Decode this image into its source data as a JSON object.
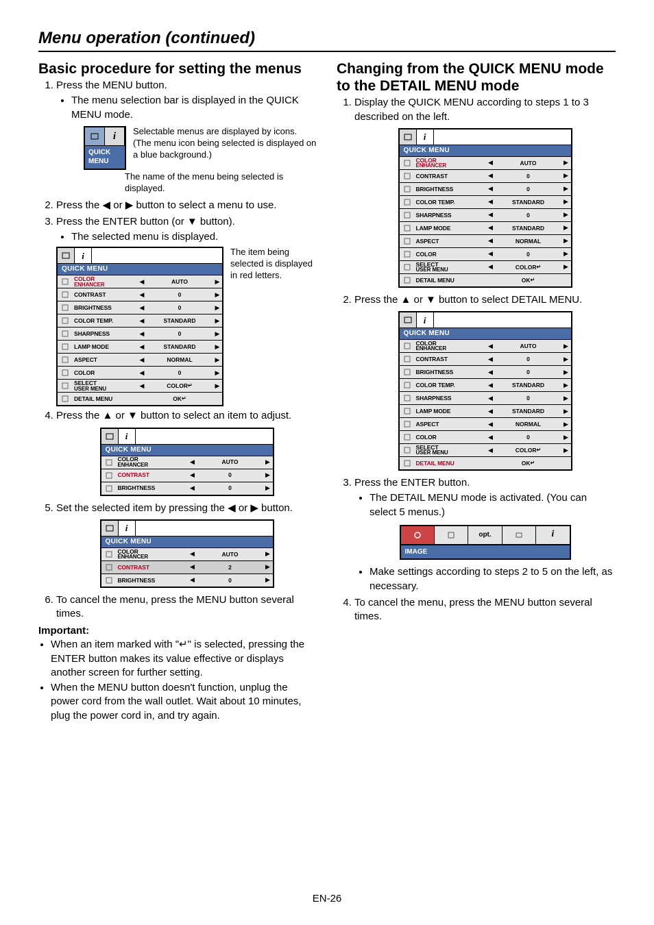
{
  "page_title": "Menu operation (continued)",
  "page_number": "EN-26",
  "left": {
    "h2": "Basic procedure for setting the menus",
    "steps": [
      "Press the MENU button.",
      "Press the ◀ or ▶ button to select a menu to use.",
      "Press the ENTER button (or ▼ button).",
      "Press the ▲ or ▼ button to select an item to adjust.",
      "Set the selected item by pressing the ◀ or ▶ button.",
      "To cancel the menu, press the MENU button several times."
    ],
    "sub1": "The menu selection bar is displayed in the QUICK MENU mode.",
    "sub3": "The selected menu is displayed.",
    "callout1": "Selectable menus are displayed by icons. (The menu icon being selected is displayed on a blue background.)",
    "callout2": "The name of the menu being selected is displayed.",
    "callout3": "The item being selected is displayed in red letters.",
    "quick_menu_label": "QUICK MENU",
    "important_label": "Important:",
    "important": [
      "When an item marked with \"↵\" is selected, pressing the ENTER button makes its value effective or displays another screen for further setting.",
      "When the MENU button doesn't function, unplug the power cord from the wall outlet. Wait about 10 minutes, plug the power cord in, and try again."
    ]
  },
  "right": {
    "h2": "Changing from the QUICK MENU mode to the DETAIL MENU mode",
    "steps": [
      "Display the QUICK MENU according to steps 1 to 3 described on the left.",
      "Press the ▲ or ▼ button to select DETAIL MENU.",
      "Press the ENTER button.",
      "To cancel the menu, press the MENU button several times."
    ],
    "sub3a": "The DETAIL MENU mode is activated. (You can select 5 menus.)",
    "sub3b": "Make settings according to steps 2 to 5 on the left, as necessary.",
    "image_label": "IMAGE",
    "opt_label": "opt."
  },
  "menu_full": {
    "header": "QUICK MENU",
    "rows": [
      {
        "label": "COLOR ENHANCER",
        "val": "AUTO",
        "ml": true,
        "arrows": true
      },
      {
        "label": "CONTRAST",
        "val": "0",
        "arrows": true
      },
      {
        "label": "BRIGHTNESS",
        "val": "0",
        "arrows": true
      },
      {
        "label": "COLOR TEMP.",
        "val": "STANDARD",
        "arrows": true
      },
      {
        "label": "SHARPNESS",
        "val": "0",
        "arrows": true
      },
      {
        "label": "LAMP MODE",
        "val": "STANDARD",
        "arrows": true
      },
      {
        "label": "ASPECT",
        "val": "NORMAL",
        "arrows": true
      },
      {
        "label": "COLOR",
        "val": "0",
        "arrows": true
      },
      {
        "label": "SELECT USER MENU",
        "val": "COLOR",
        "ml": true,
        "arrows": true,
        "enter": true
      },
      {
        "label": "DETAIL MENU",
        "val": "OK",
        "ok": true
      }
    ]
  },
  "menu_partial_a": {
    "header": "QUICK MENU",
    "rows": [
      {
        "label": "COLOR ENHANCER",
        "val": "AUTO",
        "ml": true,
        "arrows": true
      },
      {
        "label": "CONTRAST",
        "val": "0",
        "arrows": true
      },
      {
        "label": "BRIGHTNESS",
        "val": "0",
        "arrows": true
      }
    ]
  },
  "menu_partial_b": {
    "header": "QUICK MENU",
    "rows": [
      {
        "label": "COLOR ENHANCER",
        "val": "AUTO",
        "ml": true,
        "arrows": true
      },
      {
        "label": "CONTRAST",
        "val": "2",
        "arrows": true
      },
      {
        "label": "BRIGHTNESS",
        "val": "0",
        "arrows": true
      }
    ]
  }
}
